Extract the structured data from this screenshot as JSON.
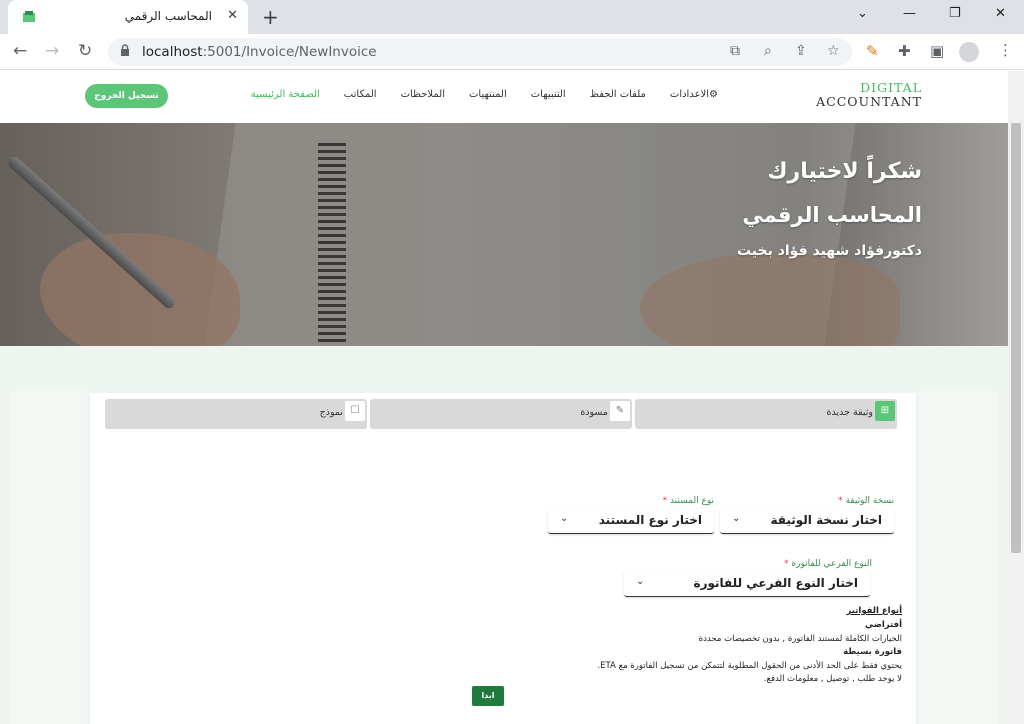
{
  "browser": {
    "tab_title": "المحاسب الرقمي",
    "url_host": "localhost",
    "url_path": ":5001/Invoice/NewInvoice"
  },
  "site": {
    "logo_line1": "DIGITAL",
    "logo_line2": "ACCOUNTANT",
    "nav": [
      "الصفحة الرئيسية",
      "المكاتب",
      "الملاحظات",
      "المنتهيات",
      "التنبيهات",
      "ملفات الحفظ",
      "⚙الاعدادات"
    ],
    "logout_label": "تسجيل الخروج"
  },
  "hero": {
    "line1": "شكراً لاختيارك",
    "line2": "المحاسب الرقمي",
    "line3": "دكتورفؤاد شهيد فؤاد بخيت"
  },
  "doc_tabs": [
    {
      "label": "وثيقة جديدة",
      "icon": "new-document-icon"
    },
    {
      "label": "مسودة",
      "icon": "draft-icon"
    },
    {
      "label": "نموذج",
      "icon": "template-icon"
    }
  ],
  "form": {
    "version_label": "نسخة الوثيقة",
    "version_value": "اختار نسخة الوثيقة",
    "doctype_label": "نوع المستند",
    "doctype_value": "اختار نوع المستند",
    "subtype_label": "النوع الفرعي للفاتورة",
    "subtype_value": "اختار النوع الفرعي للفاتورة",
    "required_mark": "*"
  },
  "info": {
    "heading": "أنواع الفواتير",
    "default_title": "أفتراضي",
    "default_desc": "الخيارات الكاملة لمستند الفاتورة , بدون تخصيصات محددة",
    "simple_title": "فاتورة بسيطة",
    "simple_desc": "يحتوي فقط على الحد الأدنى من الحقول المطلوبة لتتمكن من تسجيل الفاتورة مع ETA.",
    "simple_note": "لا يوجد طلب , توصيل , معلومات الدفع."
  },
  "submit_label": "ابدا",
  "colors": {
    "accent": "#3fbd5e",
    "button_dark": "#1f7a3e",
    "required": "#e53935"
  }
}
